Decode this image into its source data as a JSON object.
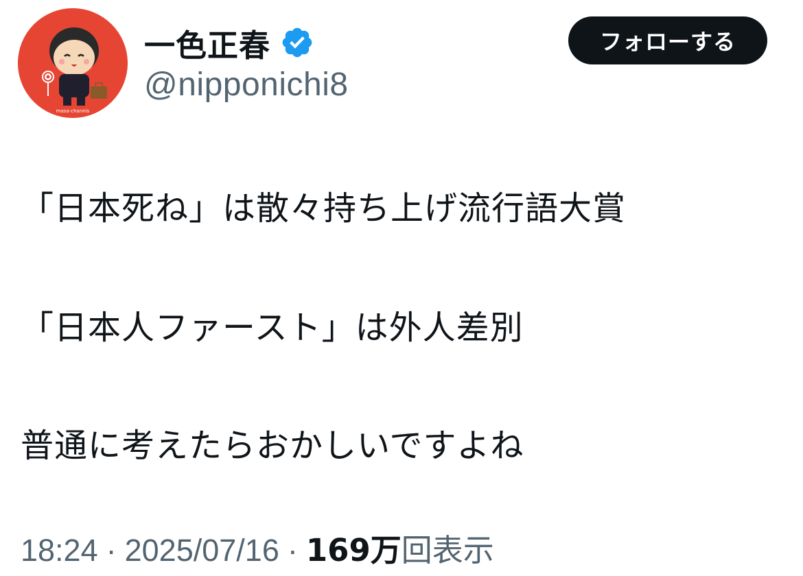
{
  "author": {
    "display_name": "一色正春",
    "handle": "@nipponichi8",
    "verified": true,
    "avatar_icon": "cartoon-boy-avatar",
    "avatar_caption": "masa-channis"
  },
  "follow_button": {
    "label": "フォローする"
  },
  "tweet": {
    "lines": [
      "「日本死ね」は散々持ち上げ流行語大賞",
      "「日本人ファースト」は外人差別",
      "普通に考えたらおかしいですよね"
    ]
  },
  "meta": {
    "time": "18:24",
    "separator": "·",
    "date": "2025/07/16",
    "views_count": "169万",
    "views_label": "回表示"
  },
  "colors": {
    "verified_badge": "#1d9bf0",
    "follow_button_bg": "#0f1419",
    "secondary_text": "#536471",
    "avatar_bg": "#e64533"
  }
}
